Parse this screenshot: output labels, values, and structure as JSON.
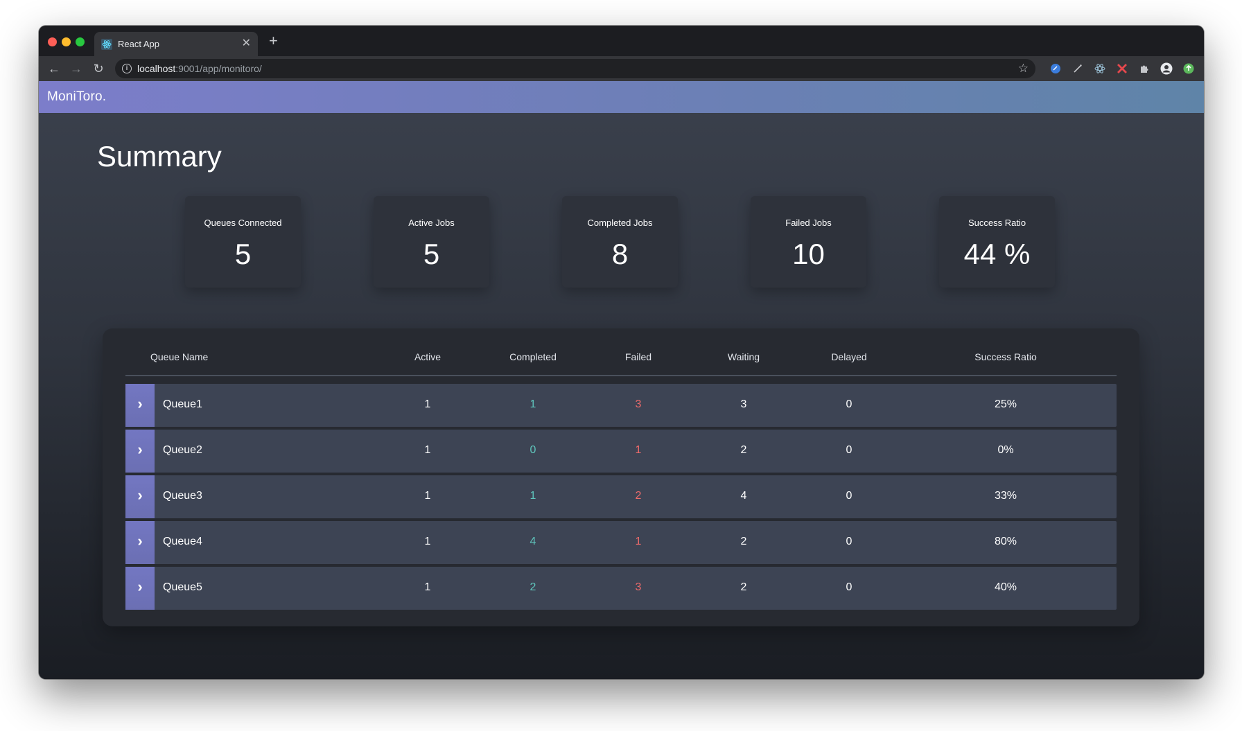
{
  "browser": {
    "tab_title": "React App",
    "tab_close": "✕",
    "new_tab": "+",
    "url_host": "localhost",
    "url_rest": ":9001/app/monitoro/",
    "star_icon": "☆"
  },
  "app": {
    "brand": "MoniToro.",
    "page_title": "Summary"
  },
  "summary_cards": [
    {
      "label": "Queues Connected",
      "value": "5"
    },
    {
      "label": "Active Jobs",
      "value": "5"
    },
    {
      "label": "Completed Jobs",
      "value": "8"
    },
    {
      "label": "Failed Jobs",
      "value": "10"
    },
    {
      "label": "Success Ratio",
      "value": "44 %"
    }
  ],
  "table": {
    "headers": {
      "name": "Queue Name",
      "active": "Active",
      "completed": "Completed",
      "failed": "Failed",
      "waiting": "Waiting",
      "delayed": "Delayed",
      "ratio": "Success Ratio"
    },
    "toggle_icon": "›",
    "rows": [
      {
        "name": "Queue1",
        "active": "1",
        "completed": "1",
        "failed": "3",
        "waiting": "3",
        "delayed": "0",
        "ratio": "25%"
      },
      {
        "name": "Queue2",
        "active": "1",
        "completed": "0",
        "failed": "1",
        "waiting": "2",
        "delayed": "0",
        "ratio": "0%"
      },
      {
        "name": "Queue3",
        "active": "1",
        "completed": "1",
        "failed": "2",
        "waiting": "4",
        "delayed": "0",
        "ratio": "33%"
      },
      {
        "name": "Queue4",
        "active": "1",
        "completed": "4",
        "failed": "1",
        "waiting": "2",
        "delayed": "0",
        "ratio": "80%"
      },
      {
        "name": "Queue5",
        "active": "1",
        "completed": "2",
        "failed": "3",
        "waiting": "2",
        "delayed": "0",
        "ratio": "40%"
      }
    ]
  },
  "colors": {
    "header_gradient_start": "#7c7dca",
    "header_gradient_end": "#5f84a8",
    "completed_text": "#5fc6bd",
    "failed_text": "#ef6b6b",
    "row_bg": "#3d4454",
    "toggle_bg": "#7377c2"
  }
}
